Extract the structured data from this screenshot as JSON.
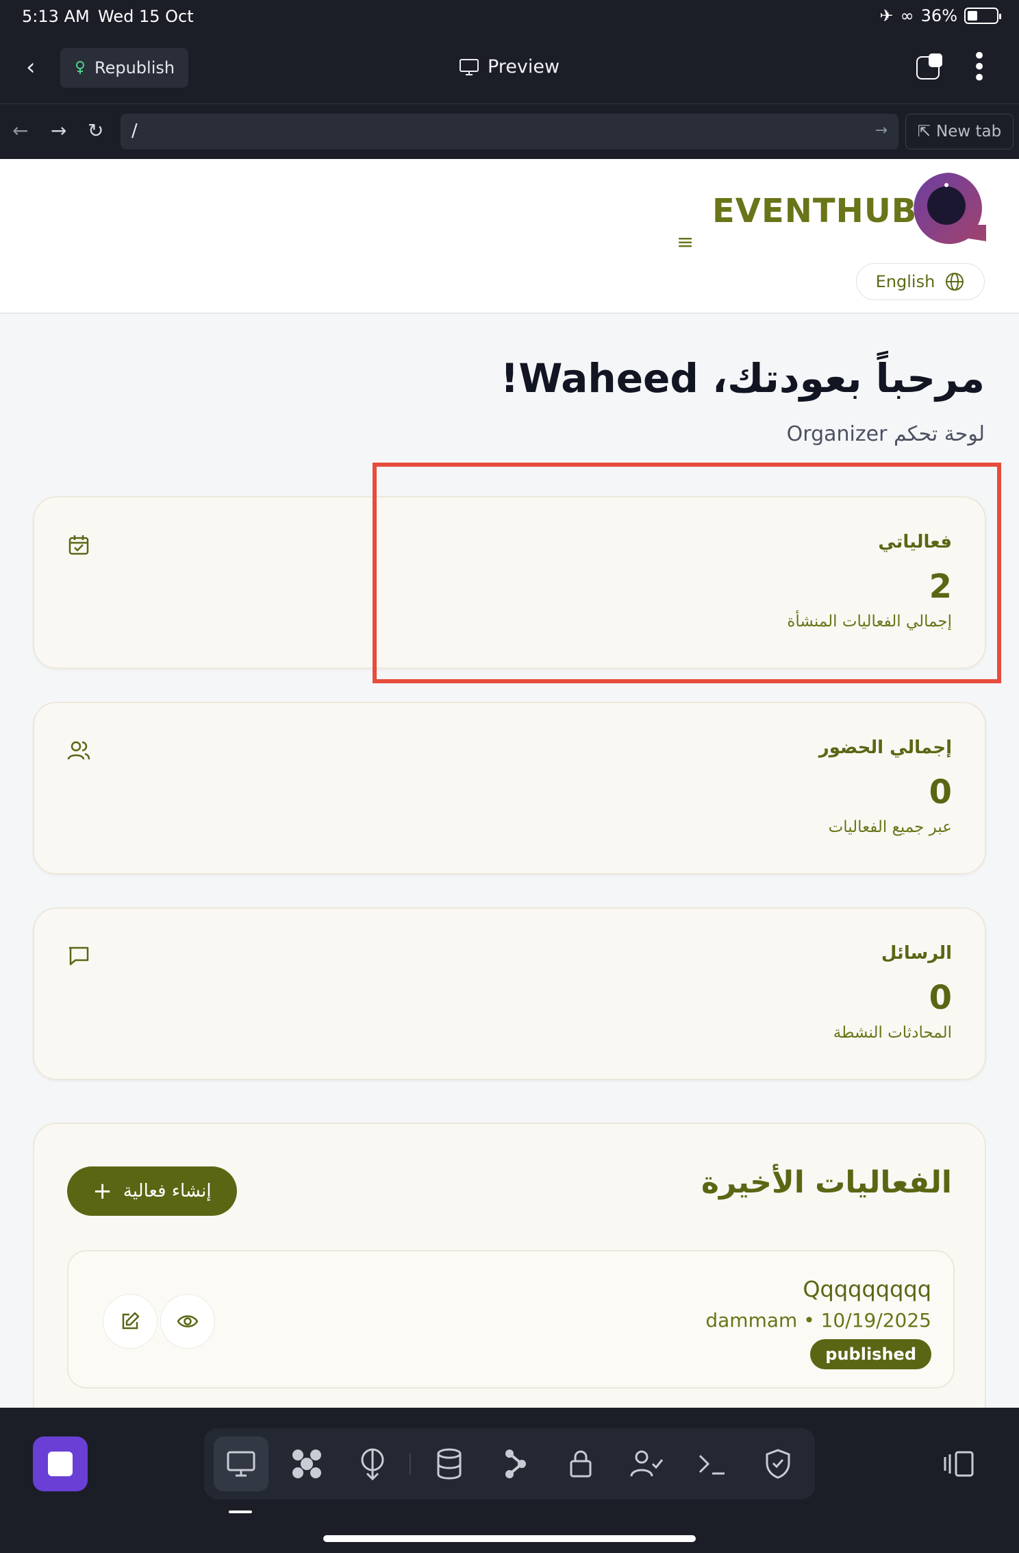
{
  "status_bar": {
    "time": "5:13 AM",
    "date": "Wed 15 Oct",
    "battery": "36%"
  },
  "toolbar": {
    "republish_label": "Republish",
    "preview_label": "Preview"
  },
  "address_bar": {
    "url": "/",
    "new_tab_label": "New tab"
  },
  "header": {
    "brand": "EVENTHUB",
    "language_label": "English"
  },
  "welcome": {
    "title": "مرحباً بعودتك، Waheed!",
    "subtitle": "لوحة تحكم Organizer"
  },
  "stats": [
    {
      "title": "فعالياتي",
      "value": "2",
      "description": "إجمالي الفعاليات المنشأة",
      "icon": "calendar-check-icon"
    },
    {
      "title": "إجمالي الحضور",
      "value": "0",
      "description": "عبر جميع الفعاليات",
      "icon": "users-icon"
    },
    {
      "title": "الرسائل",
      "value": "0",
      "description": "المحادثات النشطة",
      "icon": "message-icon"
    }
  ],
  "recent": {
    "title": "الفعاليات الأخيرة",
    "create_label": "إنشاء فعالية",
    "events": [
      {
        "name": "Qqqqqqqqq",
        "meta": "dammam • 10/19/2025",
        "status": "published"
      }
    ]
  },
  "colors": {
    "accent": "#5b6614",
    "highlight": "#e74c3c",
    "logo": "#6b3fa0"
  }
}
